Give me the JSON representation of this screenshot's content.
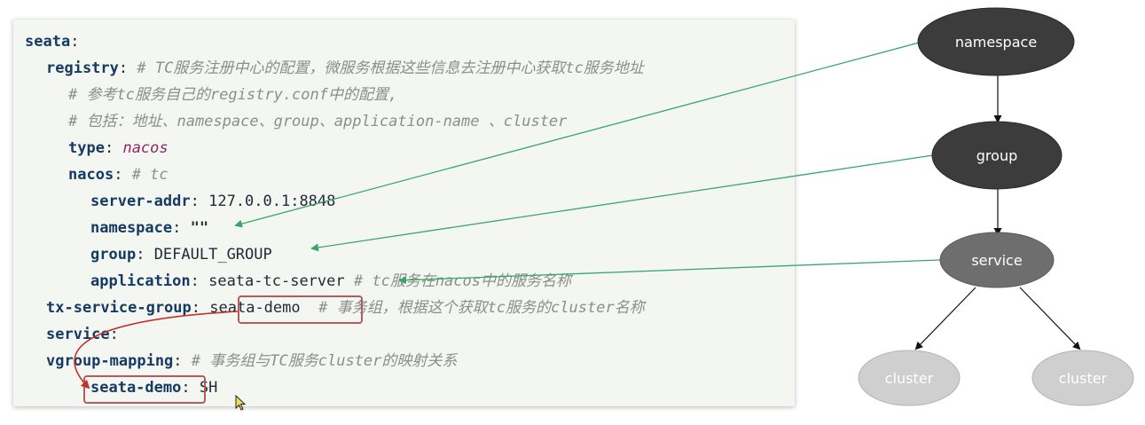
{
  "code": {
    "l1_key": "seata",
    "l2_key": "registry",
    "l2_comment": "# TC服务注册中心的配置，微服务根据这些信息去注册中心获取tc服务地址",
    "l3_comment": "# 参考tc服务自己的registry.conf中的配置,",
    "l4_comment": "# 包括：地址、namespace、group、application-name 、cluster",
    "l5_key": "type",
    "l5_value": "nacos",
    "l6_key": "nacos",
    "l6_comment": "# tc",
    "l7_key": "server-addr",
    "l7_value": "127.0.0.1:8848",
    "l8_key": "namespace",
    "l8_value": "\"\"",
    "l9_key": "group",
    "l9_value": "DEFAULT_GROUP",
    "l10_key": "application",
    "l10_value": "seata-tc-server",
    "l10_comment": "# tc服务在nacos中的服务名称",
    "l11_key": "tx-service-group",
    "l11_value": "seata-demo",
    "l11_comment": "# 事务组，根据这个获取tc服务的cluster名称",
    "l12_key": "service",
    "l13_key": "vgroup-mapping",
    "l13_comment": "# 事务组与TC服务cluster的映射关系",
    "l14_key": "seata-demo",
    "l14_value": "SH",
    "colon": ":"
  },
  "tree": {
    "namespace": "namespace",
    "group": "group",
    "service": "service",
    "cluster_left": "cluster",
    "cluster_right": "cluster"
  },
  "colors": {
    "arrow_green": "#3aa56a",
    "highlight_box": "#b85a5e",
    "arrow_red": "#c4302b",
    "node_dark": "#3c3c3c",
    "node_mid": "#6e6e6e",
    "node_light": "#cfcfcf"
  },
  "icons": {
    "cursor": "mouse-cursor-icon"
  }
}
